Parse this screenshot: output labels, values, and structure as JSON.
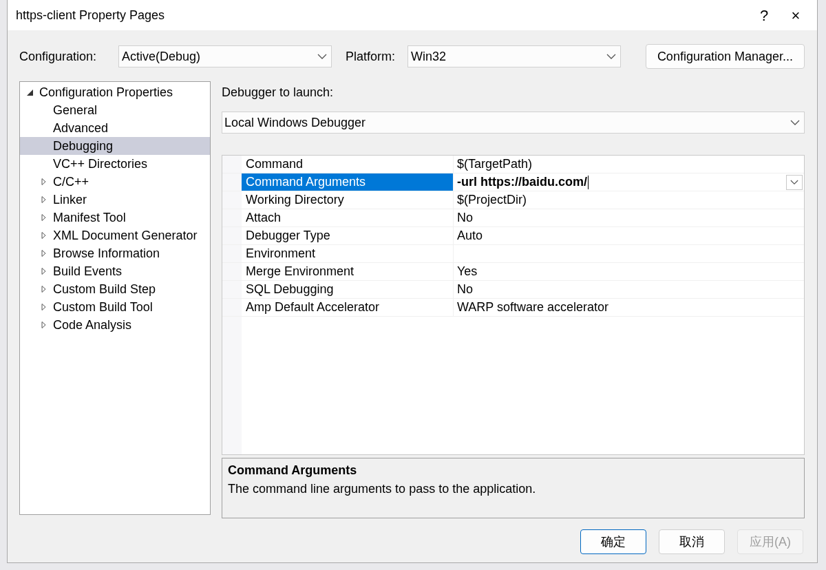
{
  "window": {
    "title": "https-client Property Pages",
    "help": "?",
    "close": "×"
  },
  "toolbar": {
    "configuration_label": "Configuration:",
    "configuration": "Active(Debug)",
    "platform_label": "Platform:",
    "platform": "Win32",
    "manager_button": "Configuration Manager..."
  },
  "tree": [
    {
      "label": "Configuration Properties",
      "kind": "group",
      "expanded": true,
      "selected": false,
      "children": [
        {
          "label": "General",
          "kind": "page",
          "selected": false
        },
        {
          "label": "Advanced",
          "kind": "page",
          "selected": false
        },
        {
          "label": "Debugging",
          "kind": "page",
          "selected": true
        },
        {
          "label": "VC++ Directories",
          "kind": "page",
          "selected": false
        },
        {
          "label": "C/C++",
          "kind": "group",
          "expanded": false,
          "selected": false
        },
        {
          "label": "Linker",
          "kind": "group",
          "expanded": false,
          "selected": false
        },
        {
          "label": "Manifest Tool",
          "kind": "group",
          "expanded": false,
          "selected": false
        },
        {
          "label": "XML Document Generator",
          "kind": "group",
          "expanded": false,
          "selected": false
        },
        {
          "label": "Browse Information",
          "kind": "group",
          "expanded": false,
          "selected": false
        },
        {
          "label": "Build Events",
          "kind": "group",
          "expanded": false,
          "selected": false
        },
        {
          "label": "Custom Build Step",
          "kind": "group",
          "expanded": false,
          "selected": false
        },
        {
          "label": "Custom Build Tool",
          "kind": "group",
          "expanded": false,
          "selected": false
        },
        {
          "label": "Code Analysis",
          "kind": "group",
          "expanded": false,
          "selected": false
        }
      ]
    }
  ],
  "debugger": {
    "label": "Debugger to launch:",
    "value": "Local Windows Debugger"
  },
  "properties": [
    {
      "name": "Command",
      "value": "$(TargetPath)",
      "selected": false
    },
    {
      "name": "Command Arguments",
      "value": "-url https://baidu.com/",
      "selected": true,
      "modified": true
    },
    {
      "name": "Working Directory",
      "value": "$(ProjectDir)",
      "selected": false
    },
    {
      "name": "Attach",
      "value": "No",
      "selected": false
    },
    {
      "name": "Debugger Type",
      "value": "Auto",
      "selected": false
    },
    {
      "name": "Environment",
      "selected": false
    },
    {
      "name": "Merge Environment",
      "value": "Yes",
      "selected": false
    },
    {
      "name": "SQL Debugging",
      "value": "No",
      "selected": false
    },
    {
      "name": "Amp Default Accelerator",
      "value": "WARP software accelerator",
      "selected": false
    }
  ],
  "description": {
    "title": "Command Arguments",
    "text": "The command line arguments to pass to the application."
  },
  "buttons": [
    {
      "label": "确定",
      "kind": "default",
      "disabled": false
    },
    {
      "label": "取消",
      "kind": "normal",
      "disabled": false
    },
    {
      "label": "应用(A)",
      "kind": "normal",
      "disabled": true
    }
  ]
}
